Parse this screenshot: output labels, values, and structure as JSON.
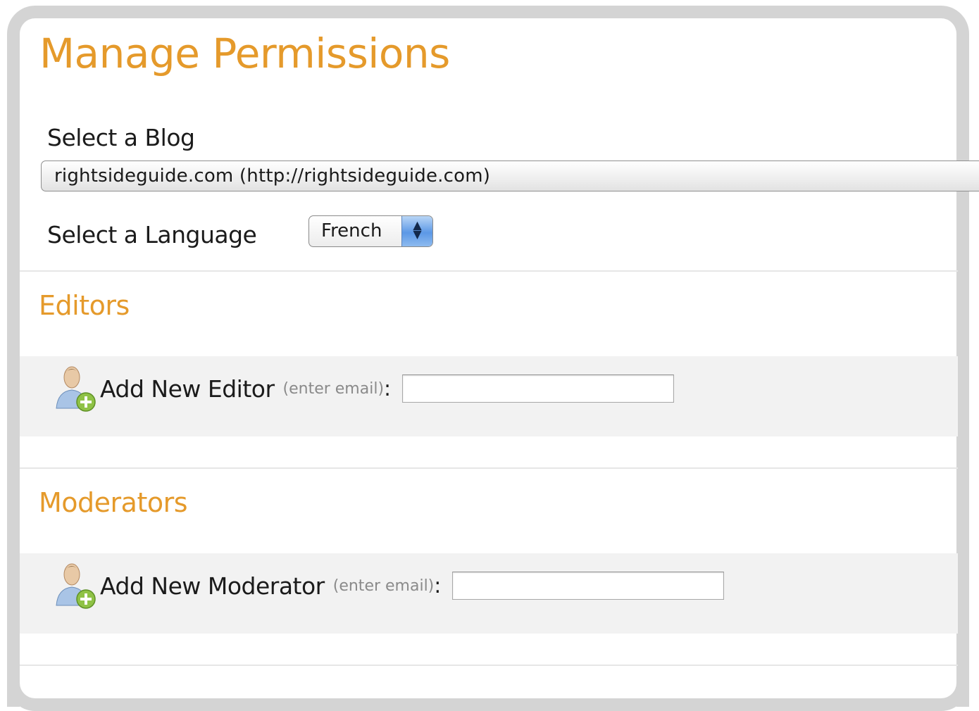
{
  "page_title": "Manage Permissions",
  "blog": {
    "label": "Select a Blog",
    "selected": "rightsideguide.com (http://rightsideguide.com)"
  },
  "language": {
    "label": "Select a Language",
    "selected": "French"
  },
  "editors": {
    "title": "Editors",
    "add_label": "Add New Editor",
    "hint": "(enter email)",
    "colon": ":",
    "icon": "add-user-icon",
    "value": ""
  },
  "moderators": {
    "title": "Moderators",
    "add_label": "Add New Moderator",
    "hint": "(enter email)",
    "colon": ":",
    "icon": "add-user-icon",
    "value": ""
  },
  "colors": {
    "accent": "#e59a2b",
    "band": "#f2f2f2",
    "frame": "#d4d4d4"
  }
}
